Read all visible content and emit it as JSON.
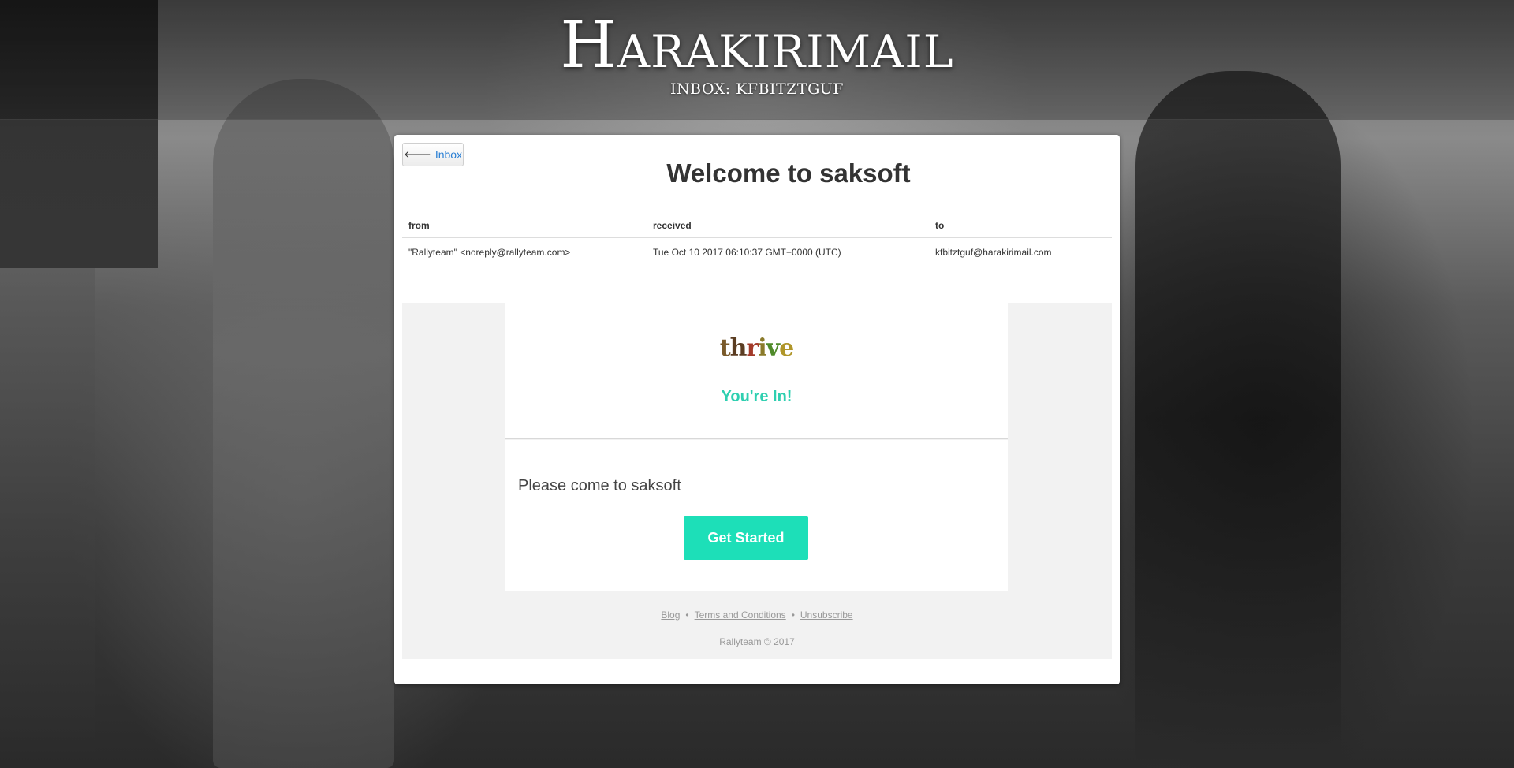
{
  "site": {
    "title": "Harakirimail",
    "inbox_label": "INBOX: KFBITZTGUF"
  },
  "message": {
    "back_label": "Inbox",
    "subject": "Welcome to saksoft",
    "headers": [
      "from",
      "received",
      "to"
    ],
    "from": "\"Rallyteam\" <noreply@rallyteam.com>",
    "received": "Tue Oct 10 2017 06:10:37 GMT+0000 (UTC)",
    "to": "kfbitztguf@harakirimail.com"
  },
  "email": {
    "logo_text": "thrive",
    "headline": "You're In!",
    "body_text": "Please come to saksoft",
    "cta_label": "Get Started",
    "footer": {
      "links": [
        "Blog",
        "Terms and Conditions",
        "Unsubscribe"
      ],
      "separator": "•",
      "copyright": "Rallyteam © 2017"
    }
  },
  "colors": {
    "accent": "#1ddfb8",
    "headline": "#2ecfb0",
    "link": "#2a7fd4"
  },
  "icons": {
    "back": "arrow-left-icon"
  }
}
